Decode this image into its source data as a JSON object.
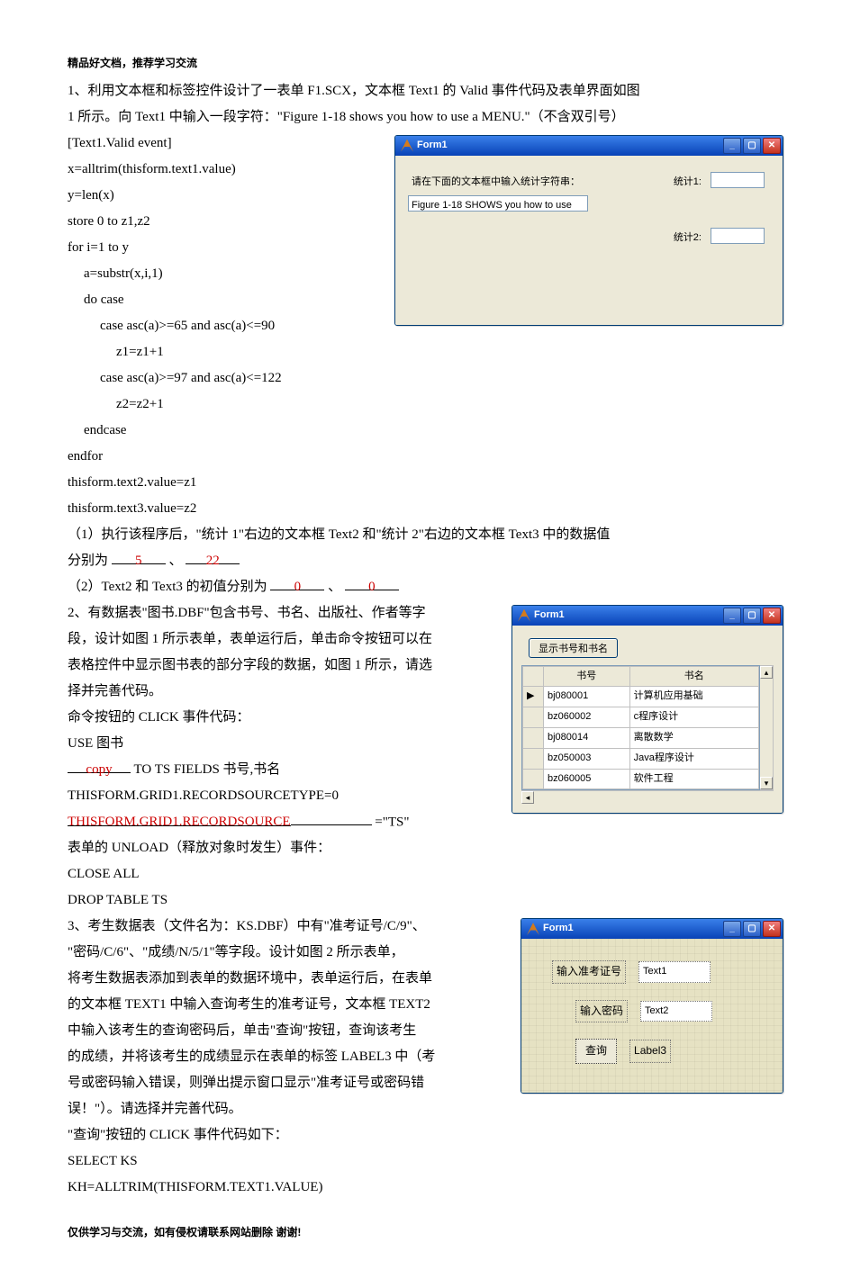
{
  "header_note": "精品好文档，推荐学习交流",
  "footer_note": "仅供学习与交流，如有侵权请联系网站删除  谢谢!",
  "q1": {
    "intro_a": "1、利用文本框和标签控件设计了一表单 F1.SCX，文本框 Text1 的 Valid 事件代码及表单界面如图",
    "intro_b": "1 所示。向 Text1 中输入一段字符：\"Figure 1-18 shows you how to use a MENU.\"（不含双引号）",
    "code_header": "[Text1.Valid event]",
    "code": [
      "x=alltrim(thisform.text1.value)",
      "y=len(x)",
      "store 0 to z1,z2",
      "for i=1 to y",
      "  a=substr(x,i,1)",
      "  do case",
      "    case asc(a)>=65 and asc(a)<=90",
      "        z1=z1+1",
      "    case asc(a)>=97 and asc(a)<=122",
      "        z2=z2+1",
      "  endcase",
      "endfor",
      "thisform.text2.value=z1",
      "thisform.text3.value=z2"
    ],
    "sub1_a": "（1）执行该程序后，\"统计 1\"右边的文本框 Text2 和\"统计 2\"右边的文本框 Text3 中的数据值",
    "sub1_b_prefix": "分别为",
    "ans1": "5",
    "sub1_sep": "、",
    "ans2": "22",
    "sub2_prefix": "（2）Text2 和 Text3 的初值分别为",
    "ans3": "0",
    "sub2_sep": "、",
    "ans4": "0",
    "form": {
      "title": "Form1",
      "prompt": "请在下面的文本框中输入统计字符串：",
      "input_value": "Figure 1-18 SHOWS you how to use",
      "stat1_label": "统计1:",
      "stat2_label": "统计2:"
    }
  },
  "q2": {
    "lines": [
      "2、有数据表\"图书.DBF\"包含书号、书名、出版社、作者等字",
      "段，设计如图 1 所示表单，表单运行后，单击命令按钮可以在",
      "表格控件中显示图书表的部分字段的数据，如图 1 所示，请选",
      "择并完善代码。",
      "命令按钮的 CLICK 事件代码："
    ],
    "use_line_prefix": "USE  图书",
    "blank1_ans": "copy",
    "blank1_suffix": "TO TS FIELDS  书号,书名",
    "line_mid": "THISFORM.GRID1.RECORDSOURCETYPE=0",
    "blank2_ans": "THISFORM.GRID1.RECORDSOURCE",
    "blank2_suffix": "=\"TS\"",
    "unload_intro": "表单的 UNLOAD（释放对象时发生）事件：",
    "unload_lines": [
      "CLOSE ALL",
      "DROP TABLE TS"
    ],
    "form": {
      "title": "Form1",
      "button": "显示书号和书名",
      "col1": "书号",
      "col2": "书名",
      "rows": [
        [
          "bj080001",
          "计算机应用基础"
        ],
        [
          "bz060002",
          "c程序设计"
        ],
        [
          "bj080014",
          "离散数学"
        ],
        [
          "bz050003",
          "Java程序设计"
        ],
        [
          "bz060005",
          "软件工程"
        ]
      ]
    }
  },
  "q3": {
    "lines": [
      "3、考生数据表（文件名为：KS.DBF）中有\"准考证号/C/9\"、",
      "\"密码/C/6\"、\"成绩/N/5/1\"等字段。设计如图 2 所示表单，",
      "将考生数据表添加到表单的数据环境中，表单运行后，在表单",
      "的文本框 TEXT1 中输入查询考生的准考证号，文本框 TEXT2",
      "中输入该考生的查询密码后，单击\"查询\"按钮，查询该考生",
      "的成绩，并将该考生的成绩显示在表单的标签 LABEL3 中（考",
      "号或密码输入错误，则弹出提示窗口显示\"准考证号或密码错",
      "误！\"）。请选择并完善代码。",
      "\"查询\"按钮的 CLICK 事件代码如下：",
      "SELECT KS",
      "KH=ALLTRIM(THISFORM.TEXT1.VALUE)"
    ],
    "form": {
      "title": "Form1",
      "label_id": "输入准考证号",
      "text1": "Text1",
      "label_pw": "输入密码",
      "text2": "Text2",
      "btn": "查询",
      "label3": "Label3"
    }
  }
}
